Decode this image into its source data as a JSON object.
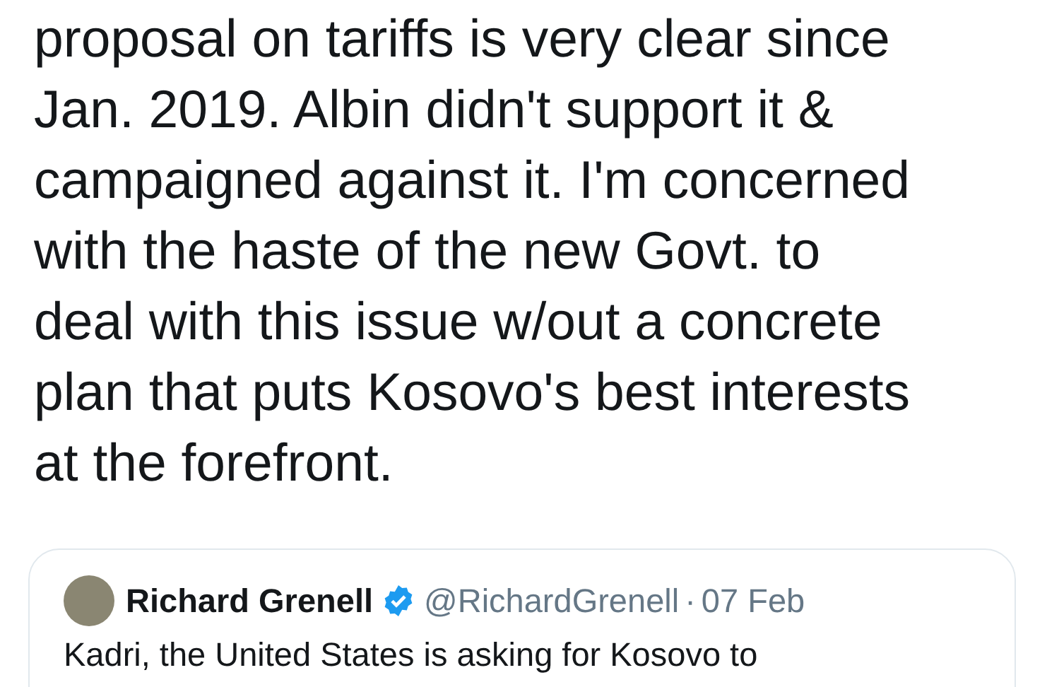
{
  "tweet": {
    "text_lines": [
      "proposal on tariffs is very clear since",
      "Jan. 2019. Albin didn't support it &",
      "campaigned against it. I'm concerned",
      "with the haste of the new Govt. to",
      "deal with this issue w/out a concrete",
      "plan that puts Kosovo's best interests",
      "at the forefront."
    ]
  },
  "quoted_tweet": {
    "name": "Richard Grenell",
    "verified": true,
    "handle": "@RichardGrenell",
    "separator": "·",
    "date": "07 Feb",
    "text": "Kadri, the United States is asking for Kosovo to"
  }
}
